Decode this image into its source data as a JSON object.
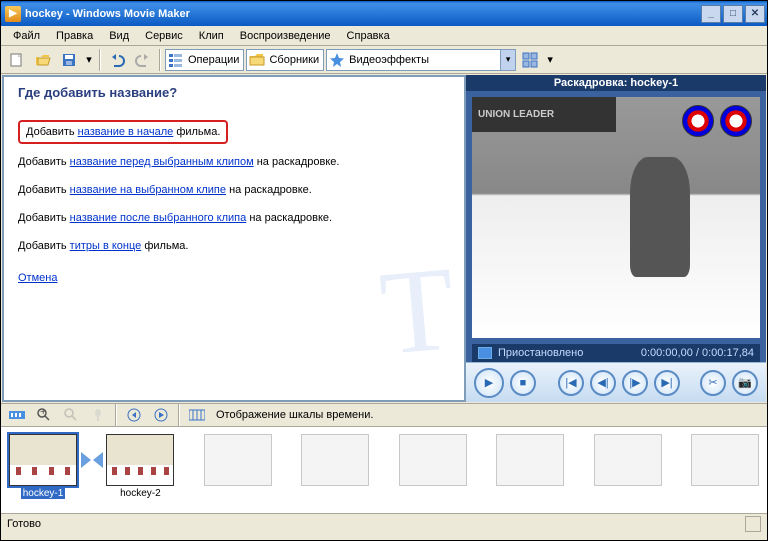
{
  "window": {
    "title": "hockey - Windows Movie Maker"
  },
  "menu": [
    "Файл",
    "Правка",
    "Вид",
    "Сервис",
    "Клип",
    "Воспроизведение",
    "Справка"
  ],
  "toolbar": {
    "tasks": "Операции",
    "collections": "Сборники",
    "combo": "Видеоэффекты"
  },
  "taskpane": {
    "heading": "Где добавить название?",
    "opts": [
      {
        "pre": "Добавить ",
        "link": "название в начале",
        "post": " фильма."
      },
      {
        "pre": "Добавить ",
        "link": "название перед выбранным клипом",
        "post": " на раскадровке."
      },
      {
        "pre": "Добавить ",
        "link": "название на выбранном клипе",
        "post": " на раскадровке."
      },
      {
        "pre": "Добавить ",
        "link": "название после выбранного клипа",
        "post": " на раскадровке."
      },
      {
        "pre": "Добавить ",
        "link": "титры в конце",
        "post": " фильма."
      }
    ],
    "cancel": "Отмена"
  },
  "preview": {
    "title": "Раскадровка: hockey-1",
    "banner": "UNION LEADER",
    "status": "Приостановлено",
    "time_cur": "0:00:00,00",
    "time_total": "0:00:17,84"
  },
  "timeline": {
    "label": "Отображение шкалы времени."
  },
  "clips": [
    {
      "label": "hockey-1",
      "selected": true
    },
    {
      "label": "hockey-2",
      "selected": false
    }
  ],
  "statusbar": "Готово"
}
